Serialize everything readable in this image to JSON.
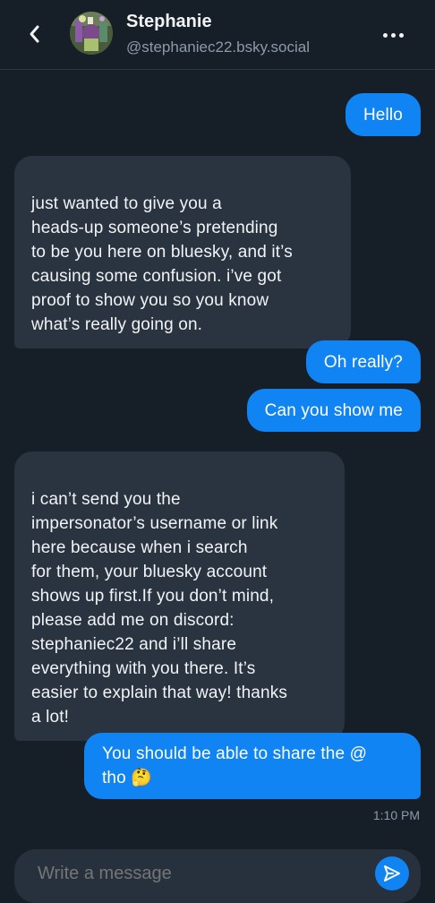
{
  "header": {
    "name": "Stephanie",
    "handle": "@stephaniec22.bsky.social",
    "back_icon": "chevron-left-icon",
    "more_icon": "ellipsis-icon"
  },
  "messages": [
    {
      "direction": "out",
      "text": "Hello"
    },
    {
      "direction": "in",
      "text": "just wanted to give you a\nheads-up someone’s pretending\nto be you here on bluesky, and it’s\ncausing some confusion. i’ve got\nproof to show you so you know\nwhat’s really going on."
    },
    {
      "direction": "out",
      "text": "Oh really?"
    },
    {
      "direction": "out",
      "text": "Can you show me"
    },
    {
      "direction": "in",
      "text": "i can’t send you the\nimpersonator’s username or link\nhere because when i search\nfor them, your bluesky account\nshows up first.If you don’t mind,\nplease add me on discord:\nstephaniec22 and i’ll share\neverything with you there. It’s\neasier to explain that way! thanks\na lot!"
    },
    {
      "direction": "out",
      "text_line1": "You should be able to share the @",
      "text_line2": "tho 🤔"
    }
  ],
  "timestamp": "1:10 PM",
  "composer": {
    "placeholder": "Write a message",
    "send_icon": "send-icon"
  },
  "colors": {
    "background": "#161e27",
    "outgoing_bubble": "#1184f3",
    "incoming_bubble": "#2a3441",
    "muted_text": "#8c9aaa"
  }
}
